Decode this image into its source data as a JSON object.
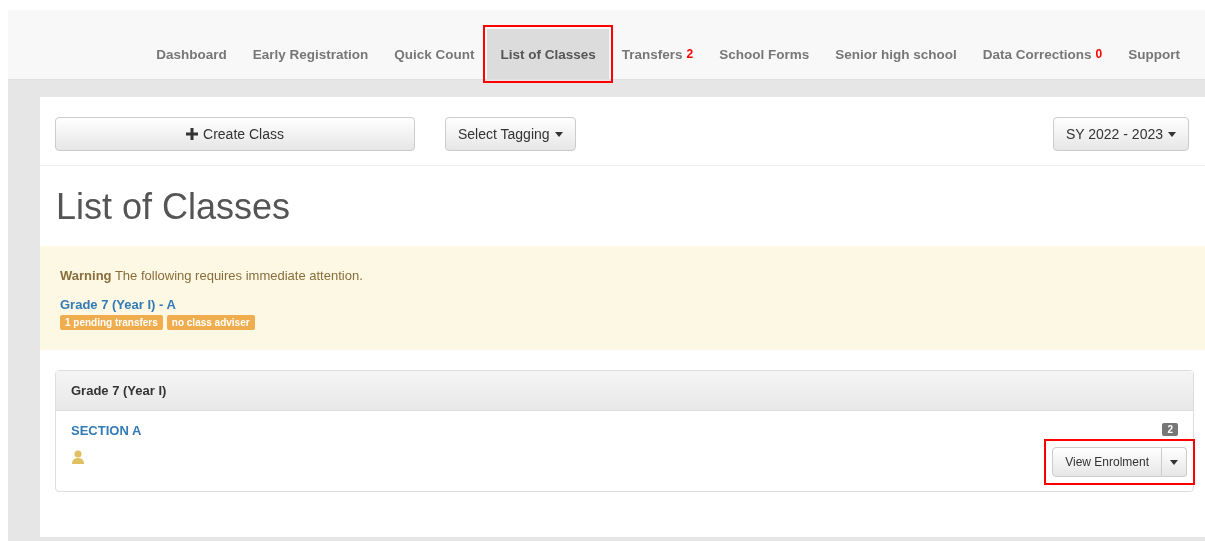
{
  "nav": [
    {
      "label": "Dashboard",
      "selected": false,
      "highlighted": false
    },
    {
      "label": "Early Registration",
      "selected": false,
      "highlighted": false
    },
    {
      "label": "Quick Count",
      "selected": false,
      "highlighted": false
    },
    {
      "label": "List of Classes",
      "selected": true,
      "highlighted": true
    },
    {
      "label": "Transfers",
      "count": "2",
      "selected": false,
      "highlighted": false
    },
    {
      "label": "School Forms",
      "selected": false,
      "highlighted": false
    },
    {
      "label": "Senior high school",
      "selected": false,
      "highlighted": false
    },
    {
      "label": "Data Corrections",
      "count": "0",
      "selected": false,
      "highlighted": false
    },
    {
      "label": "Support",
      "selected": false,
      "highlighted": false
    }
  ],
  "toolbar": {
    "create": "Create Class",
    "tagging": "Select Tagging",
    "year": "SY 2022 - 2023"
  },
  "heading": "List of Classes",
  "alert": {
    "text": "**Warning** The following requires immediate attention.",
    "link": "Grade 7 (Year I) - A",
    "tags": [
      "1 pending transfers",
      "no class adviser"
    ]
  },
  "panel": {
    "title": "Grade 7 (Year I)",
    "section": "SECTION A",
    "count": "2",
    "button": "View Enrolment",
    "highlighted": true
  }
}
